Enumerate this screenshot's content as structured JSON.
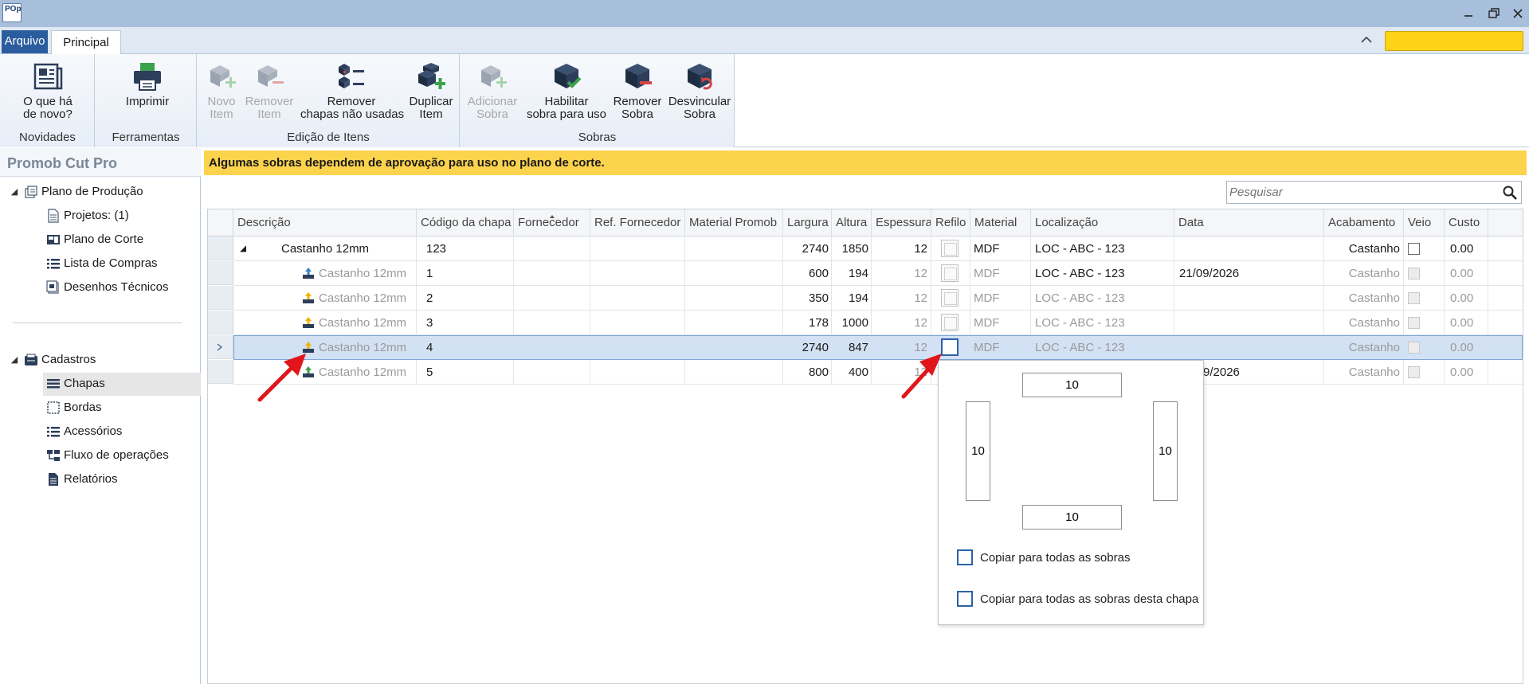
{
  "app": {
    "logo_text": "POp",
    "window_controls": [
      "minimize-icon",
      "restore-icon",
      "close-icon"
    ]
  },
  "tabs": {
    "arquivo": "Arquivo",
    "principal": "Principal"
  },
  "ribbon": {
    "groups": {
      "novidades": "Novidades",
      "ferramentas": "Ferramentas",
      "edicao": "Edição de Itens",
      "sobras": "Sobras"
    },
    "buttons": {
      "whats_new": [
        "O que há",
        "de novo?"
      ],
      "print": [
        "Imprimir"
      ],
      "new_item": [
        "Novo",
        "Item"
      ],
      "remove_item": [
        "Remover",
        "Item"
      ],
      "remove_unused": [
        "Remover",
        "chapas não usadas"
      ],
      "duplicate": [
        "Duplicar",
        "Item"
      ],
      "add_sobra": [
        "Adicionar",
        "Sobra"
      ],
      "enable_sobra": [
        "Habilitar",
        "sobra para uso"
      ],
      "remove_sobra": [
        "Remover",
        "Sobra"
      ],
      "unlink_sobra": [
        "Desvincular",
        "Sobra"
      ]
    }
  },
  "sidebar": {
    "title": "Promob Cut Pro",
    "plano_producao": "Plano de Produção",
    "projetos": "Projetos: (1)",
    "plano_corte": "Plano de Corte",
    "lista_compras": "Lista de Compras",
    "desenhos": "Desenhos Técnicos",
    "cadastros": "Cadastros",
    "chapas": "Chapas",
    "bordas": "Bordas",
    "acessorios": "Acessórios",
    "fluxo": "Fluxo de operações",
    "relatorios": "Relatórios"
  },
  "banner": "Algumas sobras dependem de aprovação para uso no plano de corte.",
  "search": {
    "placeholder": "Pesquisar"
  },
  "grid": {
    "columns": {
      "descricao": "Descrição",
      "codigo": "Código da chapa",
      "fornecedor": "Fornecedor",
      "ref_fornecedor": "Ref. Fornecedor",
      "material_promob": "Material Promob",
      "largura": "Largura",
      "altura": "Altura",
      "espessura": "Espessura",
      "refilo": "Refilo",
      "material": "Material",
      "localizacao": "Localização",
      "data": "Data",
      "acabamento": "Acabamento",
      "veio": "Veio",
      "custo": "Custo"
    },
    "rows": [
      {
        "descricao": "Castanho 12mm",
        "codigo": "123",
        "largura": "2740",
        "altura": "1850",
        "espessura": "12",
        "material": "MDF",
        "localizacao": "LOC - ABC - 123",
        "data": "",
        "acabamento": "Castanho",
        "custo": "0.00"
      },
      {
        "descricao": "Castanho 12mm",
        "codigo": "1",
        "largura": "600",
        "altura": "194",
        "espessura": "12",
        "material": "MDF",
        "localizacao": "LOC - ABC - 123",
        "data": "21/09/2026",
        "acabamento": "Castanho",
        "custo": "0.00"
      },
      {
        "descricao": "Castanho 12mm",
        "codigo": "2",
        "largura": "350",
        "altura": "194",
        "espessura": "12",
        "material": "MDF",
        "localizacao": "LOC - ABC - 123",
        "data": "",
        "acabamento": "Castanho",
        "custo": "0.00"
      },
      {
        "descricao": "Castanho 12mm",
        "codigo": "3",
        "largura": "178",
        "altura": "1000",
        "espessura": "12",
        "material": "MDF",
        "localizacao": "LOC - ABC - 123",
        "data": "",
        "acabamento": "Castanho",
        "custo": "0.00"
      },
      {
        "descricao": "Castanho 12mm",
        "codigo": "4",
        "largura": "2740",
        "altura": "847",
        "espessura": "12",
        "material": "MDF",
        "localizacao": "LOC - ABC - 123",
        "data": "",
        "acabamento": "Castanho",
        "custo": "0.00"
      },
      {
        "descricao": "Castanho 12mm",
        "codigo": "5",
        "largura": "800",
        "altura": "400",
        "espessura": "12",
        "material": "",
        "localizacao": "",
        "data": "9/2026",
        "acabamento": "Castanho",
        "custo": "0.00"
      }
    ]
  },
  "refilo_popup": {
    "top": "10",
    "left": "10",
    "right": "10",
    "bottom": "10",
    "copy_all": "Copiar para todas as sobras",
    "copy_sheet": "Copiar para todas as sobras desta chapa"
  },
  "colors": {
    "accent": "#2b5d9e",
    "banner": "#fcd34d",
    "highlight": "#ffd21a",
    "annotation_arrow": "#e0161b"
  }
}
